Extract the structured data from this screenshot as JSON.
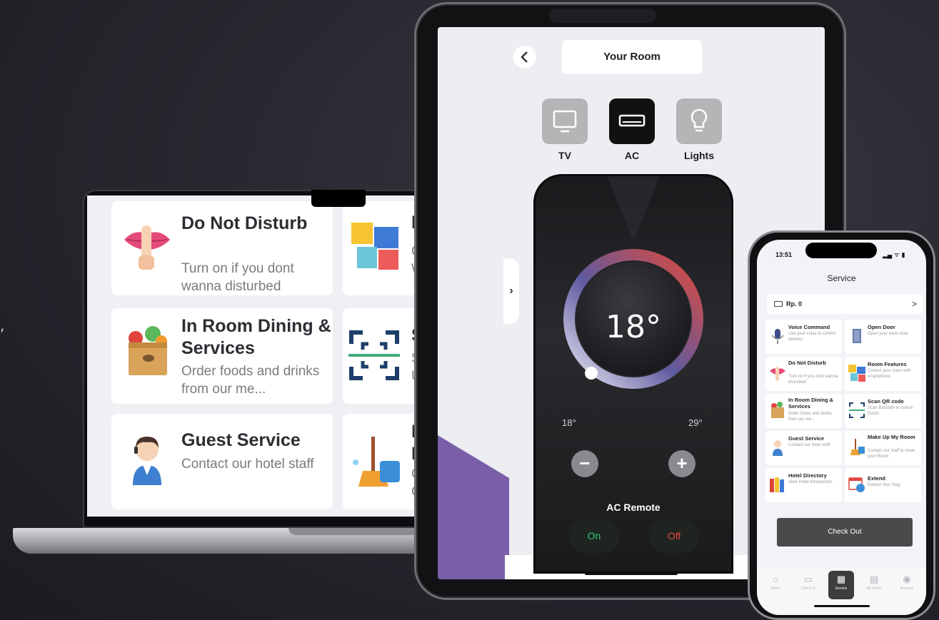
{
  "laptop": {
    "cards": [
      {
        "title": "Do Not Disturb",
        "subtitle": "Turn on if you dont wanna disturbed",
        "icon": "lips-shh-icon"
      },
      {
        "title": "In Room Dining & Services",
        "subtitle": "Order foods and drinks from our me...",
        "icon": "grocery-bag-icon"
      },
      {
        "title": "Guest Service",
        "subtitle": "Contact our hotel staff",
        "icon": "receptionist-icon"
      }
    ],
    "partial_cards": [
      {
        "title": "R",
        "subtitle": "C\nW",
        "icon": "puzzle-icon"
      },
      {
        "title": "S",
        "subtitle": "S\nU",
        "icon": "scan-qr-icon"
      },
      {
        "title": "M\nR",
        "subtitle": "C\nC",
        "icon": "cleaning-icon"
      }
    ]
  },
  "tablet": {
    "header": {
      "title": "Your Room",
      "back_icon": "chevron-left-icon"
    },
    "devices": [
      {
        "label": "TV",
        "icon": "tv-icon",
        "active": false
      },
      {
        "label": "AC",
        "icon": "ac-icon",
        "active": true
      },
      {
        "label": "Lights",
        "icon": "lightbulb-icon",
        "active": false
      }
    ],
    "remote": {
      "temperature": "18°",
      "min": "18°",
      "max": "29°",
      "minus": "−",
      "plus": "+",
      "label": "AC Remote",
      "on": "On",
      "off": "Off"
    },
    "side_tab": "›"
  },
  "phone": {
    "time": "13:51",
    "status": "▂▄ ᯤ ▮",
    "title": "Service",
    "wallet": {
      "label": "Rp. 0",
      "chevron": ">"
    },
    "cards": [
      {
        "title": "Voice Command",
        "subtitle": "Use your voice to control devices",
        "icon": "microphone-icon"
      },
      {
        "title": "Open Door",
        "subtitle": "Open your room door",
        "icon": "door-icon"
      },
      {
        "title": "Do Not Disturb",
        "subtitle": "Turn on if you dont wanna disturbed",
        "icon": "lips-shh-icon"
      },
      {
        "title": "Room Features",
        "subtitle": "Control your room with smartphone",
        "icon": "puzzle-icon"
      },
      {
        "title": "In Room Dining & Services",
        "subtitle": "Order foods and drinks from our me...",
        "icon": "grocery-bag-icon"
      },
      {
        "title": "Scan QR code",
        "subtitle": "Scan Barcode to unlock Doors",
        "icon": "scan-qr-icon"
      },
      {
        "title": "Guest Service",
        "subtitle": "Contact our hotel staff",
        "icon": "receptionist-icon"
      },
      {
        "title": "Make Up My Room",
        "subtitle": "Contact our staff to clean your Room",
        "icon": "cleaning-icon"
      },
      {
        "title": "Hotel Directory",
        "subtitle": "View Hotel Introduction",
        "icon": "books-icon"
      },
      {
        "title": "Extend",
        "subtitle": "Extend Your Stay",
        "icon": "calendar-clock-icon"
      }
    ],
    "checkout": "Check Out",
    "nav": [
      {
        "label": "Home",
        "icon": "home-icon",
        "glyph": "⌂"
      },
      {
        "label": "Check In",
        "icon": "calendar-icon",
        "glyph": "▭"
      },
      {
        "label": "Service",
        "icon": "grid-icon",
        "glyph": "▦",
        "active": true
      },
      {
        "label": "My Order",
        "icon": "receipt-icon",
        "glyph": "▤"
      },
      {
        "label": "Account",
        "icon": "user-icon",
        "glyph": "◉"
      }
    ]
  },
  "colors": {
    "accent_purple": "#7a5fa8",
    "ac_active": "#111111",
    "device_inactive": "#b5b5b8",
    "on_green": "#2ecc71",
    "off_red": "#e0483e"
  },
  "stray_glyphs": {
    "comma": ","
  }
}
